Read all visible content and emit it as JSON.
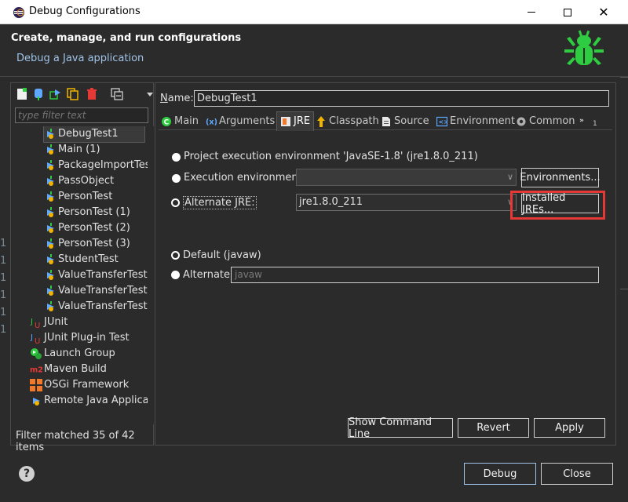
{
  "window": {
    "title": "Debug Configurations"
  },
  "header": {
    "title": "Create, manage, and run configurations",
    "subtitle": "Debug a Java application"
  },
  "left_panel": {
    "filter_placeholder": "type filter text",
    "items": [
      {
        "label": "DebugTest1",
        "icon": "java-app-icon",
        "indent": 1,
        "selected": true
      },
      {
        "label": "Main (1)",
        "icon": "java-app-icon",
        "indent": 1
      },
      {
        "label": "PackageImportTes",
        "icon": "java-app-icon",
        "indent": 1
      },
      {
        "label": "PassObject",
        "icon": "java-app-icon",
        "indent": 1
      },
      {
        "label": "PersonTest",
        "icon": "java-app-icon",
        "indent": 1
      },
      {
        "label": "PersonTest (1)",
        "icon": "java-app-icon",
        "indent": 1
      },
      {
        "label": "PersonTest (2)",
        "icon": "java-app-icon",
        "indent": 1
      },
      {
        "label": "PersonTest (3)",
        "icon": "java-app-icon",
        "indent": 1
      },
      {
        "label": "StudentTest",
        "icon": "java-app-icon",
        "indent": 1
      },
      {
        "label": "ValueTransferTest",
        "icon": "java-app-icon",
        "indent": 1
      },
      {
        "label": "ValueTransferTest",
        "icon": "java-app-icon",
        "indent": 1
      },
      {
        "label": "ValueTransferTest",
        "icon": "java-app-icon",
        "indent": 1
      },
      {
        "label": "JUnit",
        "icon": "junit-icon",
        "indent": 0
      },
      {
        "label": "JUnit Plug-in Test",
        "icon": "junit-plugin-icon",
        "indent": 0
      },
      {
        "label": "Launch Group",
        "icon": "launch-group-icon",
        "indent": 0
      },
      {
        "label": "Maven Build",
        "icon": "maven-icon",
        "indent": 0
      },
      {
        "label": "OSGi Framework",
        "icon": "osgi-icon",
        "indent": 0
      },
      {
        "label": "Remote Java Applica",
        "icon": "remote-java-icon",
        "indent": 0
      }
    ],
    "status": "Filter matched 35 of 42 items"
  },
  "right_panel": {
    "name_label": "Name:",
    "name_value": "DebugTest1",
    "tabs": [
      {
        "label": "Main",
        "icon": "main-tab-icon"
      },
      {
        "label": "Arguments",
        "icon": "arguments-tab-icon"
      },
      {
        "label": "JRE",
        "icon": "jre-tab-icon",
        "active": true
      },
      {
        "label": "Classpath",
        "icon": "classpath-tab-icon"
      },
      {
        "label": "Source",
        "icon": "source-tab-icon"
      },
      {
        "label": "Environment",
        "icon": "environment-tab-icon"
      },
      {
        "label": "Common",
        "icon": "common-tab-icon"
      },
      {
        "label": "1",
        "icon": "overflow-tab-icon"
      }
    ],
    "jre": {
      "project_env_label": "Project execution environment 'JavaSE-1.8' (jre1.8.0_211)",
      "exec_env_label": "Execution environment:",
      "exec_env_value": "",
      "environments_button": "Environments...",
      "alternate_jre_label": "Alternate JRE:",
      "alternate_jre_value": "jre1.8.0_211",
      "installed_jres_button": "Installed JREs...",
      "default_label": "Default (javaw)",
      "alternate_label": "Alternate",
      "alternate_value": "javaw"
    },
    "buttons": {
      "show_command_line": "Show Command Line",
      "revert": "Revert",
      "apply": "Apply"
    }
  },
  "footer": {
    "debug": "Debug",
    "close": "Close"
  },
  "colors": {
    "background": "#2b2b2b",
    "bug_green": "#2ecc40",
    "highlight_red": "#e53935"
  }
}
